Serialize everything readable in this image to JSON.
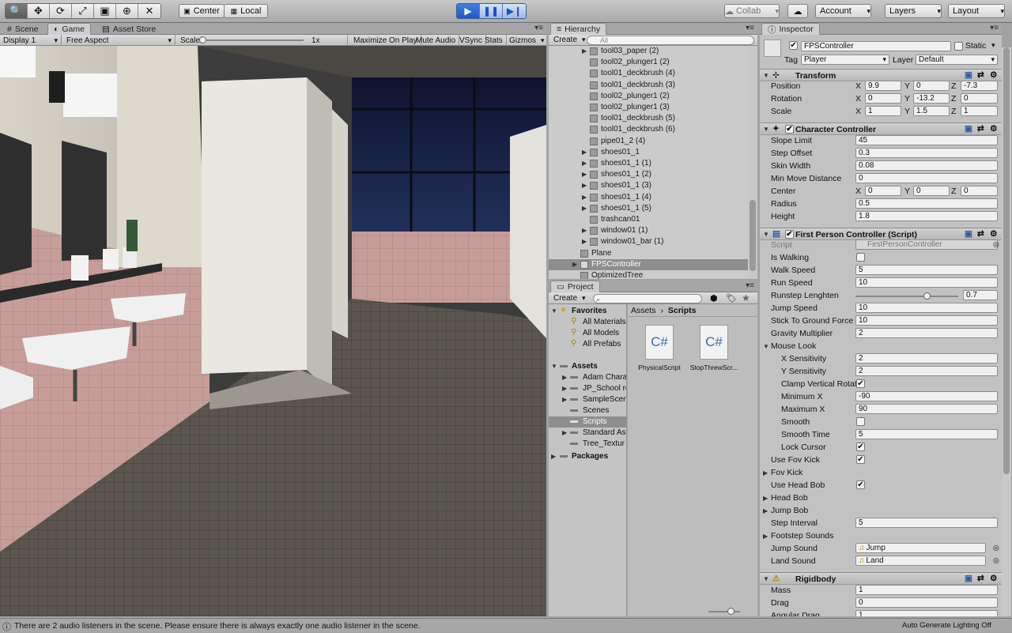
{
  "toolbar": {
    "tools": [
      "hand-icon",
      "move-icon",
      "rotate-icon",
      "scale-icon",
      "rect-icon",
      "transform-icon",
      "custom-tool-icon"
    ],
    "pivot": "Center",
    "space": "Local",
    "collab": "Collab",
    "account": "Account",
    "layers": "Layers",
    "layout": "Layout"
  },
  "tabs": {
    "scene": "Scene",
    "game": "Game",
    "asset_store": "Asset Store"
  },
  "gamebar": {
    "display": "Display 1",
    "aspect": "Free Aspect",
    "scale_label": "Scale",
    "scale_value": "1x",
    "maximize": "Maximize On Play",
    "mute": "Mute Audio",
    "vsync": "VSync",
    "stats": "Stats",
    "gizmos": "Gizmos"
  },
  "hierarchy": {
    "title": "Hierarchy",
    "create": "Create",
    "search_placeholder": "All",
    "items": [
      {
        "label": "tool03_paper (2)",
        "expand": true,
        "indent": 2
      },
      {
        "label": "tool02_plunger1 (2)",
        "expand": false,
        "indent": 2
      },
      {
        "label": "tool01_deckbrush (4)",
        "expand": false,
        "indent": 2
      },
      {
        "label": "tool01_deckbrush (3)",
        "expand": false,
        "indent": 2
      },
      {
        "label": "tool02_plunger1 (2)",
        "expand": false,
        "indent": 2
      },
      {
        "label": "tool02_plunger1 (3)",
        "expand": false,
        "indent": 2
      },
      {
        "label": "tool01_deckbrush (5)",
        "expand": false,
        "indent": 2
      },
      {
        "label": "tool01_deckbrush (6)",
        "expand": false,
        "indent": 2
      },
      {
        "label": "pipe01_2 (4)",
        "expand": false,
        "indent": 2
      },
      {
        "label": "shoes01_1",
        "expand": true,
        "indent": 2
      },
      {
        "label": "shoes01_1 (1)",
        "expand": true,
        "indent": 2
      },
      {
        "label": "shoes01_1 (2)",
        "expand": true,
        "indent": 2
      },
      {
        "label": "shoes01_1 (3)",
        "expand": true,
        "indent": 2
      },
      {
        "label": "shoes01_1 (4)",
        "expand": true,
        "indent": 2
      },
      {
        "label": "shoes01_1 (5)",
        "expand": true,
        "indent": 2
      },
      {
        "label": "trashcan01",
        "expand": false,
        "indent": 2
      },
      {
        "label": "window01 (1)",
        "expand": true,
        "indent": 2
      },
      {
        "label": "window01_bar (1)",
        "expand": true,
        "indent": 2
      },
      {
        "label": "Plane",
        "expand": false,
        "indent": 1
      },
      {
        "label": "FPSController",
        "expand": true,
        "indent": 1,
        "selected": true
      },
      {
        "label": "OptimizedTree",
        "expand": false,
        "indent": 1
      }
    ]
  },
  "project": {
    "title": "Project",
    "create": "Create",
    "breadcrumb": [
      "Assets",
      "Scripts"
    ],
    "favorites_label": "Favorites",
    "favorites": [
      "All Materials",
      "All Models",
      "All Prefabs"
    ],
    "assets_label": "Assets",
    "folders": [
      "Adam Chara",
      "JP_School re",
      "SampleScen",
      "Scenes",
      "Scripts",
      "Standard As",
      "Tree_Textur"
    ],
    "packages_label": "Packages",
    "files": [
      {
        "icon": "C#",
        "name": "PhysicalScript"
      },
      {
        "icon": "C#",
        "name": "StopThrewScr..."
      }
    ]
  },
  "inspector": {
    "title": "Inspector",
    "object_name": "FPSController",
    "static_label": "Static",
    "tag_label": "Tag",
    "tag_value": "Player",
    "layer_label": "Layer",
    "layer_value": "Default",
    "transform": {
      "title": "Transform",
      "rows": [
        {
          "label": "Position",
          "x": "9.9",
          "y": "0",
          "z": "-7.3"
        },
        {
          "label": "Rotation",
          "x": "0",
          "y": "-13.2",
          "z": "0"
        },
        {
          "label": "Scale",
          "x": "1",
          "y": "1.5",
          "z": "1"
        }
      ]
    },
    "character_controller": {
      "title": "Character Controller",
      "rows": [
        {
          "label": "Slope Limit",
          "value": "45"
        },
        {
          "label": "Step Offset",
          "value": "0.3"
        },
        {
          "label": "Skin Width",
          "value": "0.08"
        },
        {
          "label": "Min Move Distance",
          "value": "0"
        }
      ],
      "center": {
        "label": "Center",
        "x": "0",
        "y": "0",
        "z": "0"
      },
      "radius": {
        "label": "Radius",
        "value": "0.5"
      },
      "height": {
        "label": "Height",
        "value": "1.8"
      }
    },
    "fps_script": {
      "title": "First Person Controller (Script)",
      "script_label": "Script",
      "script_value": "FirstPersonController",
      "is_walking": "Is Walking",
      "walk_speed": {
        "label": "Walk Speed",
        "value": "5"
      },
      "run_speed": {
        "label": "Run Speed",
        "value": "10"
      },
      "runstep": {
        "label": "Runstep Lenghten",
        "value": "0.7",
        "fraction": 0.7
      },
      "jump_speed": {
        "label": "Jump Speed",
        "value": "10"
      },
      "stick": {
        "label": "Stick To Ground Force",
        "value": "10"
      },
      "gravity": {
        "label": "Gravity Multiplier",
        "value": "2"
      },
      "mouse_look": "Mouse Look",
      "x_sens": {
        "label": "X Sensitivity",
        "value": "2"
      },
      "y_sens": {
        "label": "Y Sensitivity",
        "value": "2"
      },
      "clamp": "Clamp Vertical Rotat",
      "min_x": {
        "label": "Minimum X",
        "value": "-90"
      },
      "max_x": {
        "label": "Maximum X",
        "value": "90"
      },
      "smooth": "Smooth",
      "smooth_time": {
        "label": "Smooth Time",
        "value": "5"
      },
      "lock_cursor": "Lock Cursor",
      "use_fov": "Use Fov Kick",
      "fov_kick": "Fov Kick",
      "use_head": "Use Head Bob",
      "head_bob": "Head Bob",
      "jump_bob": "Jump Bob",
      "step_interval": {
        "label": "Step Interval",
        "value": "5"
      },
      "footstep": "Footstep Sounds",
      "jump_sound": {
        "label": "Jump Sound",
        "value": "Jump"
      },
      "land_sound": {
        "label": "Land Sound",
        "value": "Land"
      }
    },
    "rigidbody": {
      "title": "Rigidbody",
      "mass": {
        "label": "Mass",
        "value": "1"
      },
      "drag": {
        "label": "Drag",
        "value": "0"
      },
      "angular": {
        "label": "Angular Drag",
        "value": "1"
      }
    }
  },
  "status": {
    "message": "There are 2 audio listeners in the scene. Please ensure there is always exactly one audio listener in the scene.",
    "lighting": "Auto Generate Lighting Off"
  }
}
